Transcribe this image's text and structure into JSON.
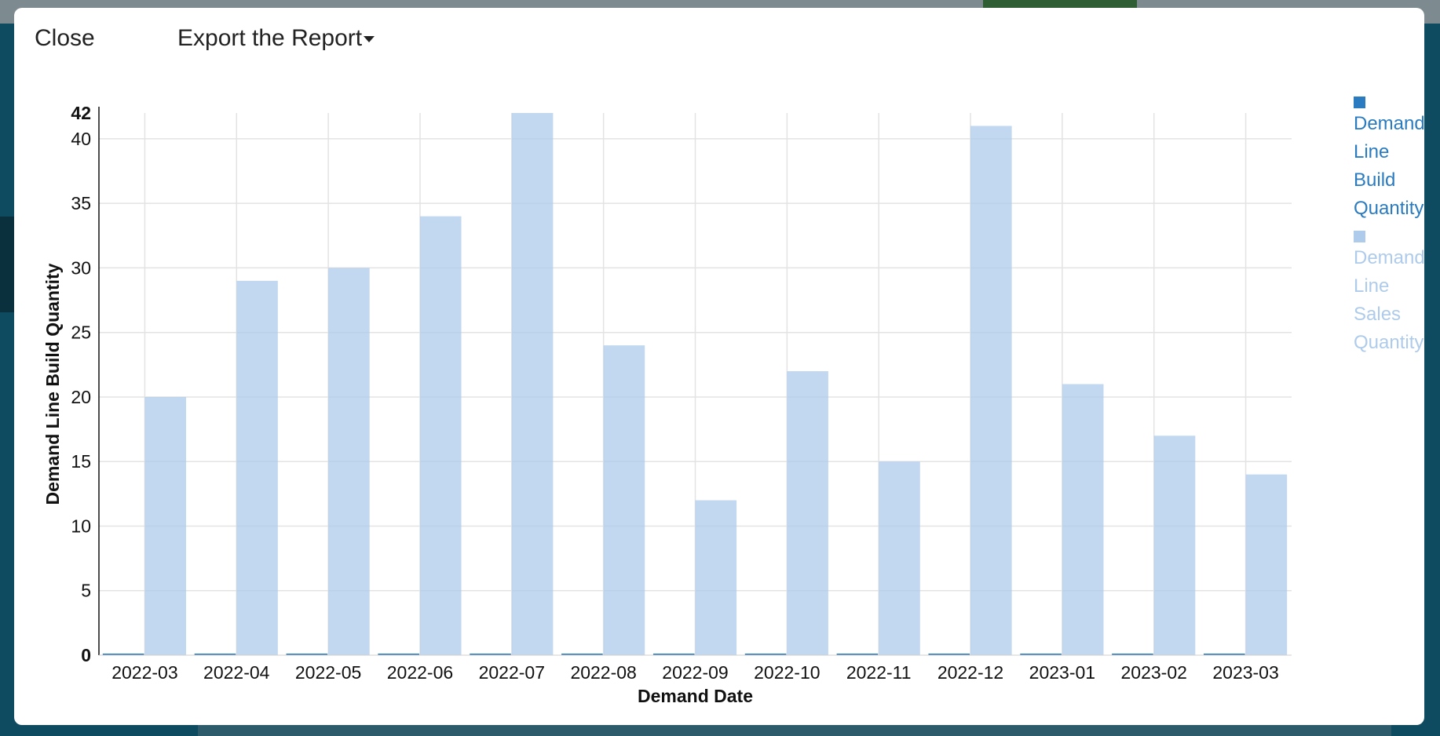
{
  "dialog": {
    "close_label": "Close",
    "export_label": "Export the Report"
  },
  "legend": [
    {
      "words": [
        "Demand",
        "Line",
        "Build",
        "Quantity"
      ],
      "color": "#2a7bbf"
    },
    {
      "words": [
        "Demand",
        "Line",
        "Sales",
        "Quantity"
      ],
      "color": "#aecbeb"
    }
  ],
  "chart_data": {
    "type": "bar",
    "categories": [
      "2022-03",
      "2022-04",
      "2022-05",
      "2022-06",
      "2022-07",
      "2022-08",
      "2022-09",
      "2022-10",
      "2022-11",
      "2022-12",
      "2023-01",
      "2023-02",
      "2023-03"
    ],
    "series": [
      {
        "name": "Demand Line Build Quantity",
        "values": [
          0,
          0,
          0,
          0,
          0,
          0,
          0,
          0,
          0,
          0,
          0,
          0,
          0
        ],
        "color": "#2a7bbf"
      },
      {
        "name": "Demand Line Sales Quantity",
        "values": [
          20,
          29,
          30,
          34,
          42,
          24,
          12,
          22,
          15,
          41,
          21,
          17,
          14
        ],
        "color": "#aecbeb"
      }
    ],
    "xlabel": "Demand Date",
    "ylabel": "Demand Line Build Quantity",
    "ylim": [
      0,
      42
    ],
    "yticks": [
      5,
      10,
      15,
      20,
      25,
      30,
      35,
      40
    ],
    "ytick_min_label": "0",
    "ytick_max_label": "42",
    "grid": true
  }
}
